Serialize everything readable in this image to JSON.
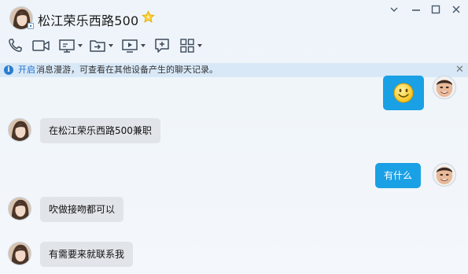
{
  "window": {
    "title": "松江荣乐西路500",
    "controls": [
      "dropdown",
      "minimize",
      "maximize",
      "close"
    ]
  },
  "toolbar": {
    "items": [
      {
        "icon": "phone-icon"
      },
      {
        "icon": "video-icon"
      },
      {
        "icon": "screen-share-icon",
        "has_menu": true
      },
      {
        "icon": "file-transfer-icon",
        "has_menu": true
      },
      {
        "icon": "remote-desktop-icon",
        "has_menu": true
      },
      {
        "icon": "add-chat-icon"
      },
      {
        "icon": "apps-grid-icon",
        "has_menu": true
      }
    ]
  },
  "notice": {
    "link": "开启",
    "text": "消息漫游，可查看在其他设备产生的聊天记录。"
  },
  "messages": [
    {
      "side": "out",
      "type": "emoji",
      "emoji": "smiley"
    },
    {
      "side": "in",
      "text": "在松江荣乐西路500兼职"
    },
    {
      "side": "out",
      "text": "有什么"
    },
    {
      "side": "in",
      "text": "吹做接吻都可以"
    },
    {
      "side": "in",
      "text": "有需要来就联系我"
    }
  ],
  "colors": {
    "accent": "#1aa0e4",
    "notice_bg": "#d8e8f7",
    "incoming_bubble": "#e1e4e8",
    "link": "#1a6fd0"
  }
}
